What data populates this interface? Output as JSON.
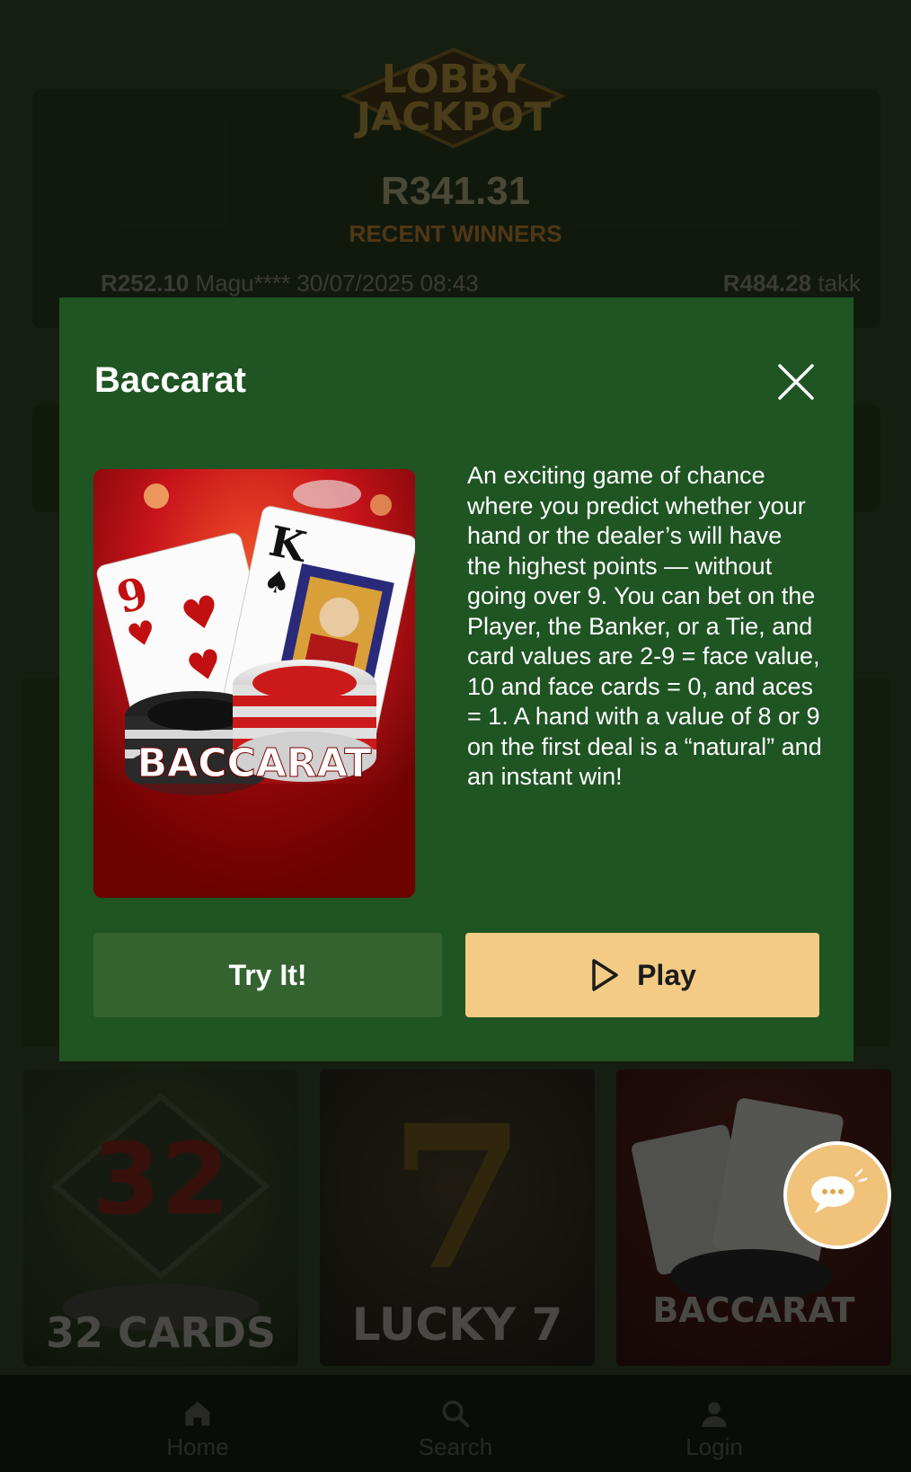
{
  "jackpot": {
    "logo_line1": "LOBBY",
    "logo_line2": "JACKPOT",
    "amount": "R341.31",
    "recent_label": "RECENT WINNERS",
    "ticker": [
      {
        "amount": "R252.10",
        "user": "Magu****",
        "time": "30/07/2025 08:43"
      },
      {
        "amount": "R484.28",
        "user": "takk"
      }
    ]
  },
  "tiles": [
    {
      "label": "32 CARDS",
      "art_text": "32"
    },
    {
      "label": "LUCKY 7",
      "art_text": "7"
    },
    {
      "label": "BACCARAT",
      "art_text": ""
    }
  ],
  "bottom_nav": [
    {
      "label": "Home",
      "icon": "home-icon"
    },
    {
      "label": "Search",
      "icon": "search-icon"
    },
    {
      "label": "Login",
      "icon": "user-icon"
    }
  ],
  "modal": {
    "title": "Baccarat",
    "thumbnail_text": "BACCARAT",
    "description": "An exciting game of chance where you predict whether your hand or the dealer’s will have the highest points — without going over 9. You can bet on the Player, the Banker, or a Tie, and card values are 2-9 = face value, 10 and face cards = 0, and aces = 1. A hand with a value of 8 or 9 on the first deal is a “natural” and an instant win!",
    "try_label": "Try It!",
    "play_label": "Play"
  },
  "colors": {
    "modal_bg": "#1f5423",
    "try_button": "#34632f",
    "play_button": "#f3cb84",
    "chat_button": "#f1c27a"
  }
}
